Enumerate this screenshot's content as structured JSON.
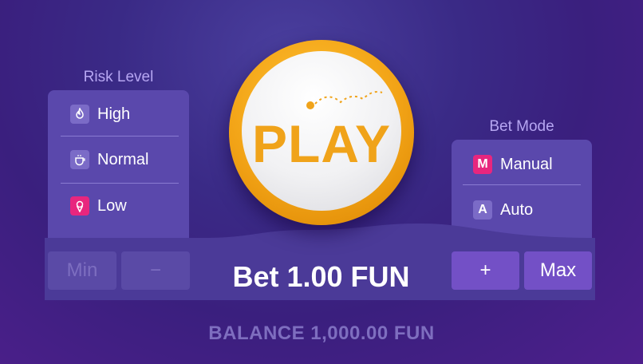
{
  "risk": {
    "title": "Risk Level",
    "options": [
      {
        "label": "High",
        "icon": "flame-icon"
      },
      {
        "label": "Normal",
        "icon": "coffee-cup-icon"
      },
      {
        "label": "Low",
        "icon": "ice-cream-icon"
      }
    ]
  },
  "mode": {
    "title": "Bet Mode",
    "options": [
      {
        "label": "Manual",
        "icon_text": "M"
      },
      {
        "label": "Auto",
        "icon_text": "A"
      }
    ]
  },
  "play": {
    "label": "PLAY"
  },
  "bet": {
    "text": "Bet 1.00 FUN",
    "min_label": "Min",
    "minus_label": "−",
    "plus_label": "+",
    "max_label": "Max"
  },
  "balance": {
    "text": "BALANCE 1,000.00 FUN"
  },
  "colors": {
    "accent_pink": "#e8267e",
    "play_orange": "#f0a31a",
    "panel": "#5a48ac"
  }
}
